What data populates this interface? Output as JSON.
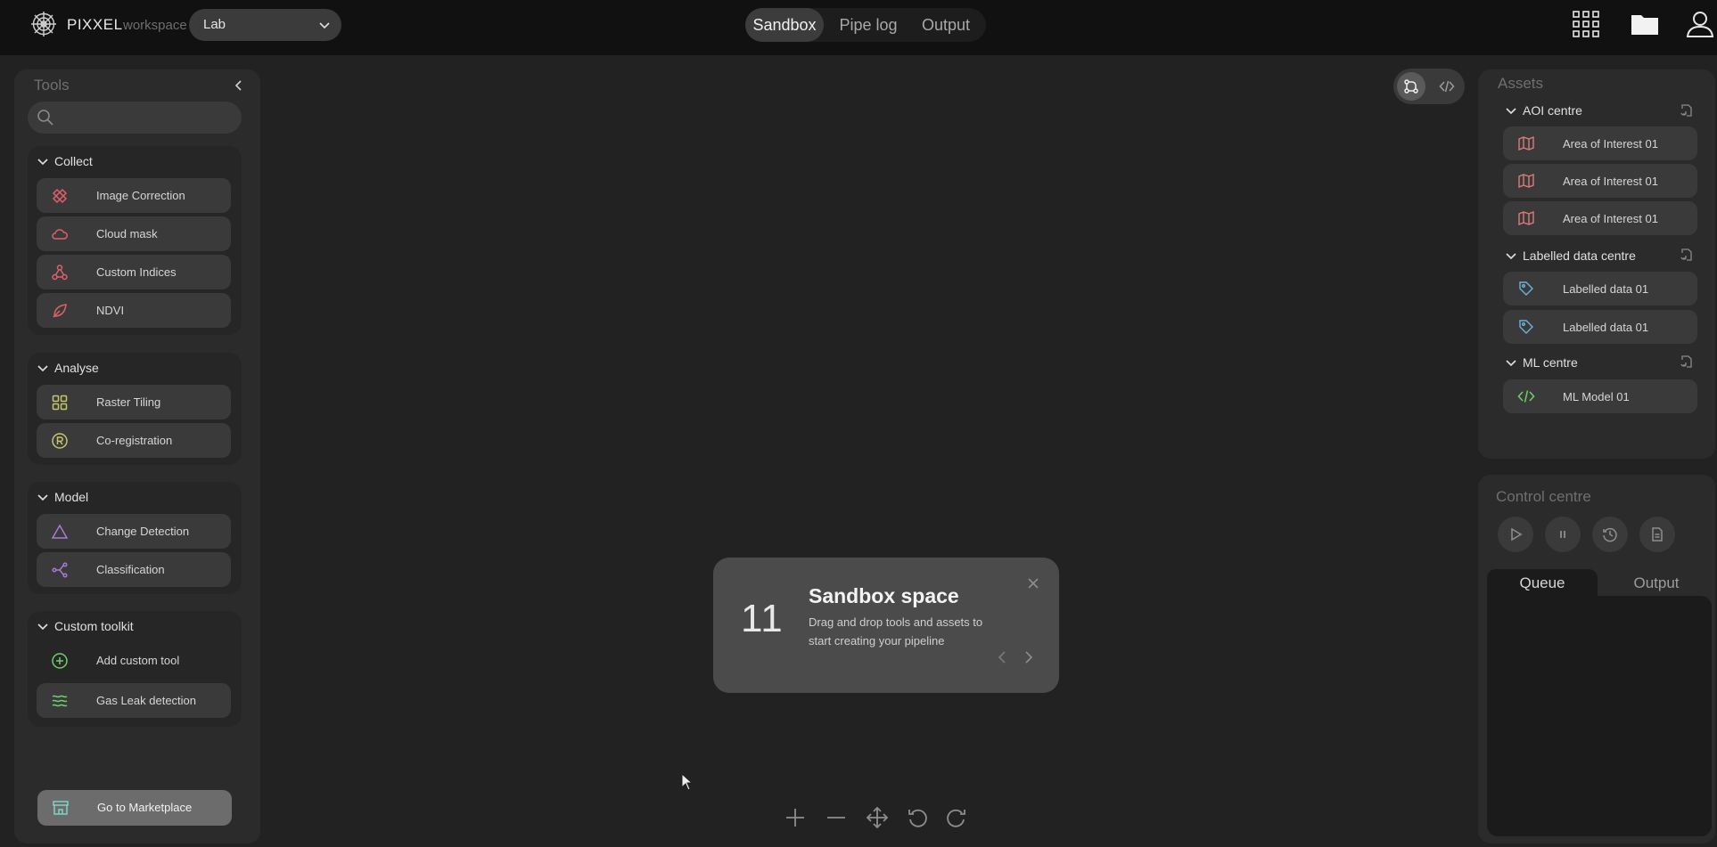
{
  "header": {
    "brand": "PIXXEL",
    "workspace_label": "workspace",
    "workspace_value": "Lab",
    "tabs": [
      {
        "label": "Sandbox",
        "active": true
      },
      {
        "label": "Pipe log",
        "active": false
      },
      {
        "label": "Output",
        "active": false
      }
    ],
    "icons": [
      "apps-grid-icon",
      "folder-icon",
      "user-icon"
    ]
  },
  "tools": {
    "title": "Tools",
    "search_placeholder": "",
    "groups": [
      {
        "title": "Collect",
        "items": [
          {
            "label": "Image Correction",
            "icon": "image-correction-icon"
          },
          {
            "label": "Cloud mask",
            "icon": "cloud-icon"
          },
          {
            "label": "Custom Indices",
            "icon": "nodes-icon"
          },
          {
            "label": "NDVI",
            "icon": "leaf-icon"
          }
        ]
      },
      {
        "title": "Analyse",
        "items": [
          {
            "label": "Raster Tiling",
            "icon": "grid-tiles-icon"
          },
          {
            "label": "Co-registration",
            "icon": "registered-icon"
          }
        ]
      },
      {
        "title": "Model",
        "items": [
          {
            "label": "Change Detection",
            "icon": "triangle-icon"
          },
          {
            "label": "Classification",
            "icon": "branch-icon"
          }
        ]
      },
      {
        "title": "Custom toolkit",
        "items": [
          {
            "label": "Add custom tool",
            "icon": "plus-circle-icon"
          },
          {
            "label": "Gas Leak detection",
            "icon": "waves-icon"
          }
        ]
      }
    ],
    "marketplace_label": "Go to Marketplace"
  },
  "canvas": {
    "welcome": {
      "number": "11",
      "title": "Sandbox space",
      "description": "Drag and drop tools and assets to start creating your pipeline"
    }
  },
  "assets": {
    "title": "Assets",
    "groups": [
      {
        "title": "AOI centre",
        "items": [
          "Area of Interest 01",
          "Area of Interest 01",
          "Area of Interest 01"
        ]
      },
      {
        "title": "Labelled data centre",
        "items": [
          "Labelled data 01",
          "Labelled data 01"
        ]
      },
      {
        "title": "ML centre",
        "items": [
          "ML Model 01"
        ]
      }
    ]
  },
  "control": {
    "title": "Control centre",
    "tabs": [
      {
        "label": "Queue",
        "active": true
      },
      {
        "label": "Output",
        "active": false
      }
    ]
  },
  "colors": {
    "collect_accent": "#e0606a",
    "analyse_accent": "#c7c56a",
    "model_accent": "#a67ad8",
    "custom_accent": "#6fcf6a",
    "aoi_accent": "#d97c7c",
    "labelled_accent": "#6ab4d8",
    "ml_accent": "#6fcf6a",
    "market_accent": "#7fd3c4"
  }
}
